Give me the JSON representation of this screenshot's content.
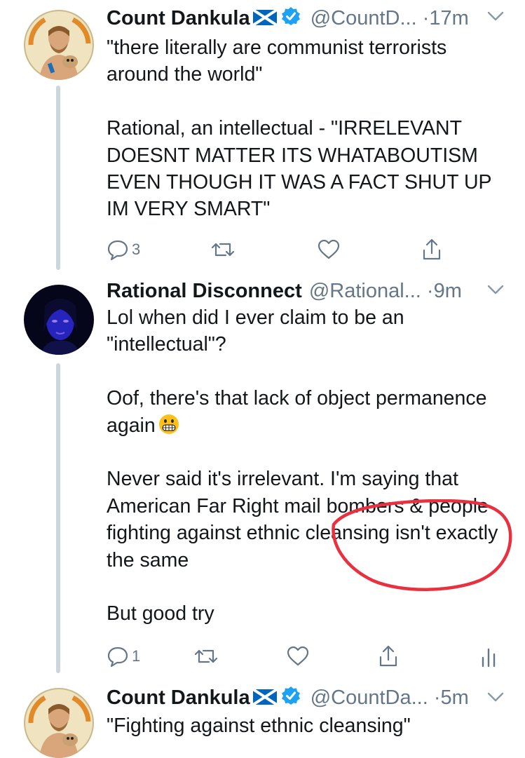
{
  "tweets": [
    {
      "name": "Count Dankula",
      "handle": "@CountD...",
      "dot": "·",
      "time": "17m",
      "paragraphs": [
        "\"there literally are communist terrorists around the world\"",
        "Rational, an intellectual - \"IRRELEVANT DOESNT MATTER ITS WHATABOUTISM EVEN THOUGH IT WAS A FACT SHUT UP IM VERY SMART\""
      ],
      "reply_count": "3"
    },
    {
      "name": "Rational Disconnect",
      "handle": "@Rational...",
      "dot": "·",
      "time": "9m",
      "paragraphs": [
        "Lol when did I ever claim to be an \"intellectual\"?",
        "Oof, there's that lack of object permanence again",
        "Never said it's irrelevant. I'm saying that American Far Right mail bombers & people fighting against ethnic cleansing isn't exactly the same",
        "But good try"
      ],
      "reply_count": "1"
    },
    {
      "name": "Count Dankula",
      "handle": "@CountDa...",
      "dot": "·",
      "time": "5m",
      "paragraphs": [
        "\"Fighting against ethnic cleansing\""
      ]
    }
  ],
  "colors": {
    "text": "#14171a",
    "secondary": "#657786",
    "verified_blue": "#1da1f2",
    "thread_line": "#ccd6dd",
    "annotation_red": "#e8303f"
  },
  "icons": [
    "reply-icon",
    "retweet-icon",
    "like-icon",
    "share-icon",
    "analytics-icon",
    "verified-icon",
    "scotland-flag-icon",
    "chevron-down-icon",
    "grimacing-emoji"
  ]
}
